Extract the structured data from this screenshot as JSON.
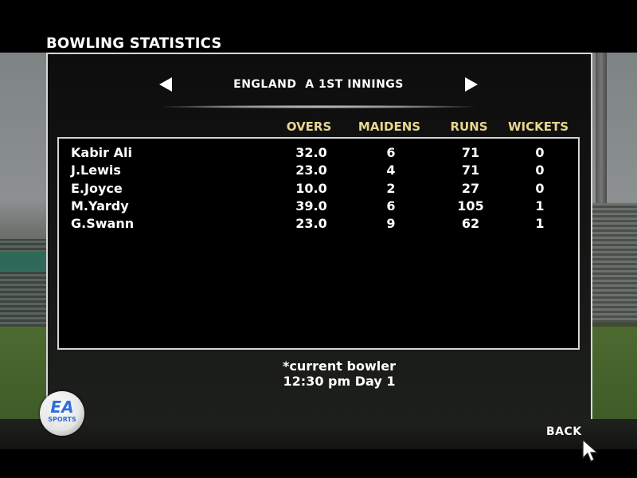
{
  "screen_title": "BOWLING STATISTICS",
  "innings_label": "ENGLAND  A 1ST INNINGS",
  "columns": {
    "overs": "OVERS",
    "maidens": "MAIDENS",
    "runs": "RUNS",
    "wickets": "WICKETS"
  },
  "bowlers": [
    {
      "name": "Kabir Ali",
      "overs": "32.0",
      "maidens": "6",
      "runs": "71",
      "wickets": "0"
    },
    {
      "name": "J.Lewis",
      "overs": "23.0",
      "maidens": "4",
      "runs": "71",
      "wickets": "0"
    },
    {
      "name": "E.Joyce",
      "overs": "10.0",
      "maidens": "2",
      "runs": "27",
      "wickets": "0"
    },
    {
      "name": "M.Yardy",
      "overs": "39.0",
      "maidens": "6",
      "runs": "105",
      "wickets": "1"
    },
    {
      "name": "G.Swann",
      "overs": "23.0",
      "maidens": "9",
      "runs": "62",
      "wickets": "1"
    }
  ],
  "footnote": {
    "current_bowler": "*current bowler",
    "time": "12:30 pm Day 1"
  },
  "back_label": "BACK",
  "logo": {
    "mark": "EA",
    "sub": "SPORTS"
  },
  "icons": {
    "prev": "arrow-left-icon",
    "next": "arrow-right-icon",
    "cursor": "mouse-cursor-icon"
  },
  "colors": {
    "header": "#e8d590",
    "text": "#ffffff",
    "brand": "#2e6fd8"
  }
}
